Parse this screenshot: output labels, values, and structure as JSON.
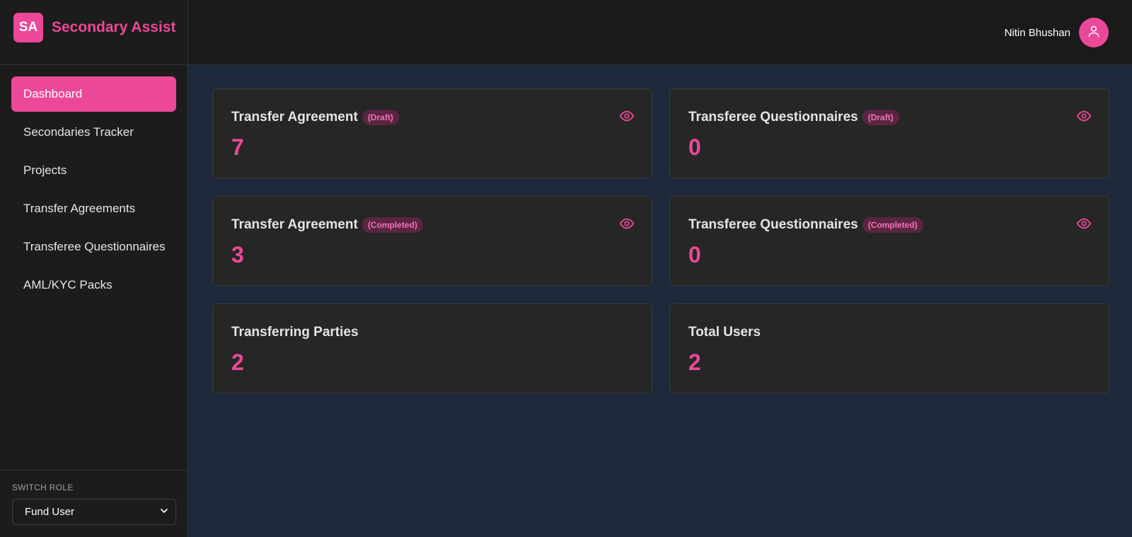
{
  "brand": {
    "logo": "SA",
    "name": "Secondary Assist"
  },
  "nav": {
    "items": [
      {
        "label": "Dashboard",
        "active": true
      },
      {
        "label": "Secondaries Tracker"
      },
      {
        "label": "Projects"
      },
      {
        "label": "Transfer Agreements"
      },
      {
        "label": "Transferee Questionnaires"
      },
      {
        "label": "AML/KYC Packs"
      }
    ]
  },
  "role": {
    "label": "SWITCH ROLE",
    "selected": "Fund User"
  },
  "header": {
    "user_name": "Nitin Bhushan",
    "avatar_icon": "user-icon"
  },
  "cards": [
    {
      "title": "Transfer Agreement",
      "badge": "(Draft)",
      "value": "7",
      "icon": "eye-icon"
    },
    {
      "title": "Transferee Questionnaires",
      "badge": "(Draft)",
      "value": "0",
      "icon": "eye-icon"
    },
    {
      "title": "Transfer Agreement",
      "badge": "(Completed)",
      "value": "3",
      "icon": "eye-icon"
    },
    {
      "title": "Transferee Questionnaires",
      "badge": "(Completed)",
      "value": "0",
      "icon": "eye-icon"
    },
    {
      "title": "Transferring Parties",
      "value": "2"
    },
    {
      "title": "Total Users",
      "value": "2"
    }
  ],
  "colors": {
    "accent": "#ec4899",
    "sidebar": "#1c1c1c",
    "content_bg": "#1e293b",
    "card_bg": "#262626"
  }
}
